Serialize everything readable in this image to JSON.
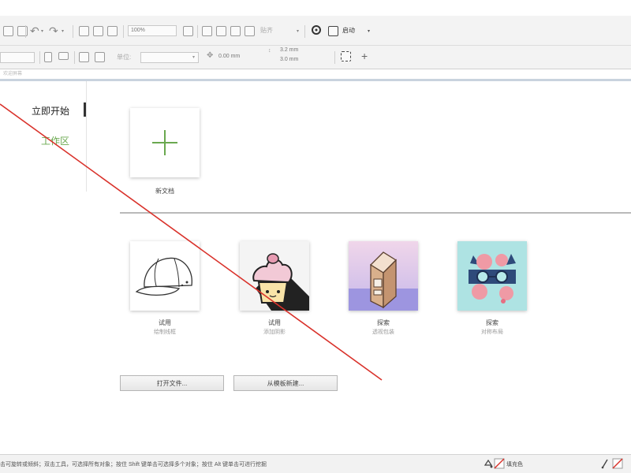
{
  "toolbar": {
    "zoom_value": "100%",
    "snap_label": "贴齐",
    "launch_label": "启动",
    "width_value": "3.2 mm",
    "height_value": "3.0 mm",
    "nudge_value": "0.00 mm",
    "unit_label": "单位:"
  },
  "panel_tab": {
    "label": "欢迎屏幕"
  },
  "sidebar": {
    "items": [
      {
        "label": "立即开始",
        "color": "#222222",
        "active": true
      },
      {
        "label": "工作区",
        "color": "#6aa84f",
        "active": false
      }
    ]
  },
  "new_document": {
    "label": "新文档",
    "icon": "plus-icon",
    "icon_color": "#6aa84f"
  },
  "templates": [
    {
      "title": "试用",
      "subtitle": "绘制线框",
      "icon": "baseball-cap-illustration"
    },
    {
      "title": "试用",
      "subtitle": "添加阴影",
      "icon": "cupcake-illustration"
    },
    {
      "title": "探索",
      "subtitle": "透视包装",
      "icon": "milk-carton-illustration"
    },
    {
      "title": "探索",
      "subtitle": "对称布局",
      "icon": "glasses-illustration"
    }
  ],
  "buttons": {
    "open_file": "打开文件...",
    "from_template": "从模板新建..."
  },
  "statusbar": {
    "hint": "击可旋转或倾斜；双击工具，可选择所有对象；按住 Shift 键单击可选择多个对象；按住 Alt 键单击可进行挖掘",
    "fill_label": "填充色"
  },
  "annotation": {
    "arrow_color": "#d9322b"
  }
}
